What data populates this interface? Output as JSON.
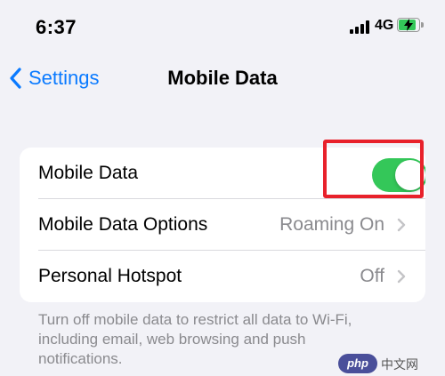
{
  "status_bar": {
    "time": "6:37",
    "network": "4G",
    "battery_level": 0.85,
    "icons": [
      "cellular-signal-icon",
      "battery-charging-icon"
    ]
  },
  "nav": {
    "back_label": "Settings",
    "title": "Mobile Data"
  },
  "settings": {
    "rows": [
      {
        "label": "Mobile Data",
        "control": "toggle",
        "toggle_on": true
      },
      {
        "label": "Mobile Data Options",
        "value": "Roaming On"
      },
      {
        "label": "Personal Hotspot",
        "value": "Off"
      }
    ]
  },
  "footer": {
    "text": "Turn off mobile data to restrict all data to Wi-Fi, including email, web browsing and push notifications."
  },
  "watermark": {
    "logo": "php",
    "text": "中文网"
  },
  "colors": {
    "accent": "#0a7aff",
    "toggle_on": "#34c759",
    "highlight": "#e8212b",
    "background": "#f2f2f7",
    "secondary_text": "#8a8a8e"
  }
}
